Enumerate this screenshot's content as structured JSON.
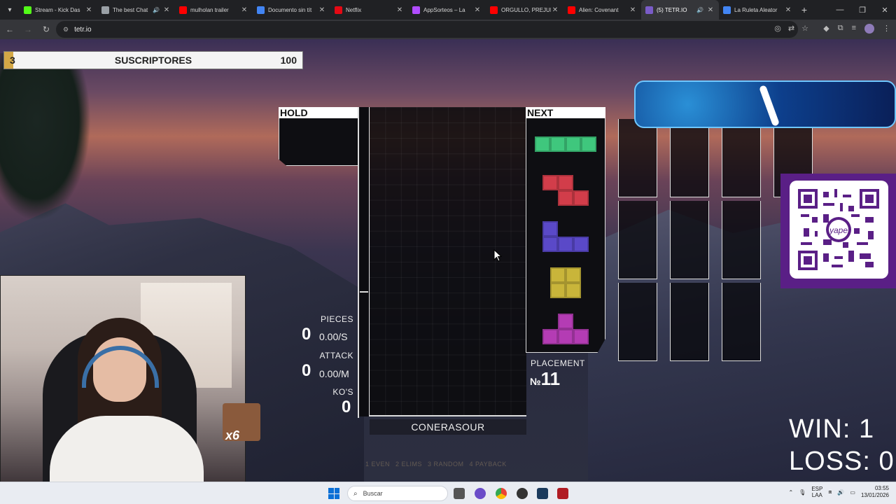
{
  "browser": {
    "tabs": [
      {
        "label": "Stream - Kick Das",
        "favicon_color": "#53fc18",
        "active": false,
        "audio": false
      },
      {
        "label": "The best Chat",
        "favicon_color": "#9aa0a6",
        "active": false,
        "audio": true
      },
      {
        "label": "mulholan trailer",
        "favicon_color": "#ff0000",
        "active": false,
        "audio": false
      },
      {
        "label": "Documento sin tít",
        "favicon_color": "#4285f4",
        "active": false,
        "audio": false
      },
      {
        "label": "Netflix",
        "favicon_color": "#e50914",
        "active": false,
        "audio": false
      },
      {
        "label": "AppSorteos – La",
        "favicon_color": "#b04cff",
        "active": false,
        "audio": false
      },
      {
        "label": "ORGULLO, PREJUI",
        "favicon_color": "#ff0000",
        "active": false,
        "audio": false
      },
      {
        "label": "Alien: Covenant",
        "favicon_color": "#ff0000",
        "active": false,
        "audio": false
      },
      {
        "label": "(5) TETR.IO",
        "favicon_color": "#7a5cc8",
        "active": true,
        "audio": true
      },
      {
        "label": "La Ruleta Aleator",
        "favicon_color": "#4285f4",
        "active": false,
        "audio": false
      }
    ],
    "url": "tetr.io"
  },
  "subs_bar": {
    "count": "3",
    "label": "SUSCRIPTORES",
    "goal": "100",
    "fill_fraction": 0.03
  },
  "game": {
    "hold_label": "HOLD",
    "next_label": "NEXT",
    "stats": {
      "pieces_label": "PIECES",
      "pieces_value": "0",
      "pieces_rate": "0.00/S",
      "attack_label": "ATTACK",
      "attack_value": "0",
      "attack_rate": "0.00/M",
      "kos_label": "KO'S",
      "kos_value": "0"
    },
    "placement_label": "PLACEMENT",
    "placement_prefix": "№",
    "placement_value": "11",
    "username": "CONERASOUR",
    "modes": [
      "1 EVEN",
      "2 ELIMS",
      "3 RANDOM",
      "4 PAYBACK"
    ],
    "next_queue": [
      {
        "piece": "I",
        "color": "#3fc77d"
      },
      {
        "piece": "Z",
        "color": "#d23d4a"
      },
      {
        "piece": "J",
        "color": "#5a49c8"
      },
      {
        "piece": "O",
        "color": "#c9b53a"
      },
      {
        "piece": "T",
        "color": "#b43cb4"
      }
    ]
  },
  "overlay": {
    "win_text": "WIN: 1",
    "loss_text": "LOSS: 0",
    "emote_multiplier": "x6",
    "qr_brand": "yape"
  },
  "taskbar": {
    "search_placeholder": "Buscar",
    "lang_top": "ESP",
    "lang_bottom": "LAA",
    "time": "03:55",
    "date": "13/01/2026"
  },
  "colors": {
    "accent_gold": "#d4a846",
    "qr_purple": "#5a1f86"
  }
}
